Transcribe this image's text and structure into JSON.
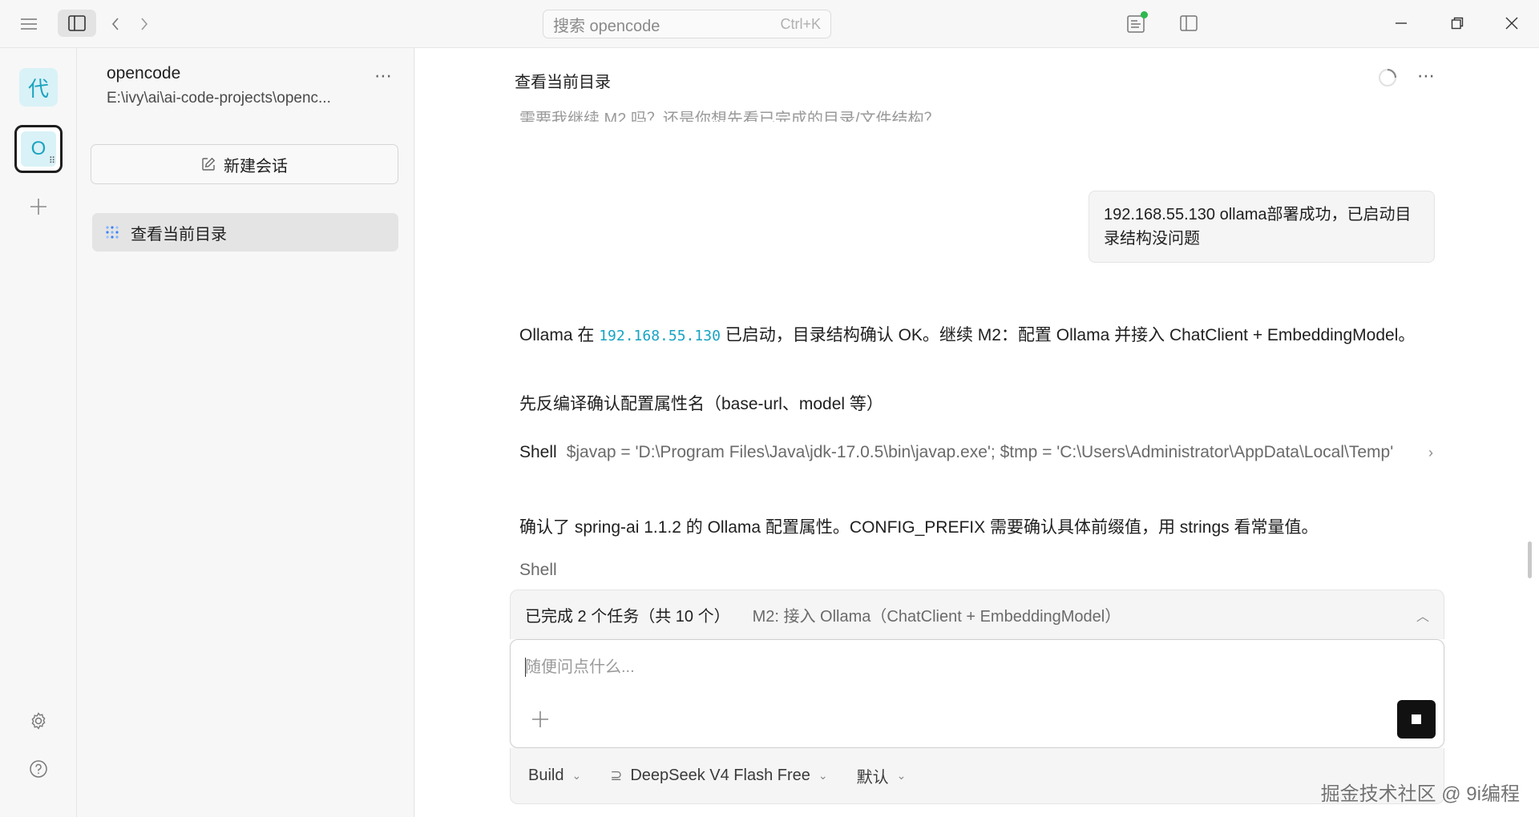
{
  "titlebar": {
    "search_placeholder": "搜索 opencode",
    "search_shortcut": "Ctrl+K",
    "review_status_color": "#2cb84f"
  },
  "rail": {
    "projects": [
      {
        "label": "代",
        "active": false
      },
      {
        "label": "O",
        "active": true
      }
    ]
  },
  "sidebar": {
    "project_name": "opencode",
    "project_path": "E:\\ivy\\ai\\ai-code-projects\\openc...",
    "new_session_label": "新建会话",
    "sessions": [
      {
        "title": "查看当前目录"
      }
    ]
  },
  "main": {
    "session_title": "查看当前目录",
    "faded_previous": "需要我继续 M2 吗？还是你想先看已完成的目录/文件结构？",
    "user_message": "192.168.55.130 ollama部署成功，已启动目录结构没问题",
    "reply": {
      "p1_prefix": "Ollama 在 ",
      "p1_code": "192.168.55.130",
      "p1_suffix": " 已启动，目录结构确认 OK。继续 M2：配置 Ollama 并接入 ChatClient + EmbeddingModel。",
      "p2": "先反编译确认配置属性名（base-url、model 等）",
      "shell_label": "Shell",
      "shell_cmd": "$javap = 'D:\\Program Files\\Java\\jdk-17.0.5\\bin\\javap.exe'; $tmp = 'C:\\Users\\Administrator\\AppData\\Local\\Temp'",
      "p3": "确认了 spring-ai 1.1.2 的 Ollama 配置属性。CONFIG_PREFIX 需要确认具体前缀值，用 strings 看常量值。",
      "shell2_label": "Shell"
    },
    "tasks": {
      "done_text": "已完成 2 个任务（共 10 个）",
      "current_text": "M2: 接入 Ollama（ChatClient + EmbeddingModel）"
    },
    "composer": {
      "placeholder": "随便问点什么..."
    },
    "toolbar": {
      "agent": "Build",
      "model": "DeepSeek V4 Flash Free",
      "variant": "默认"
    }
  },
  "watermark": "掘金技术社区 @ 9i编程"
}
